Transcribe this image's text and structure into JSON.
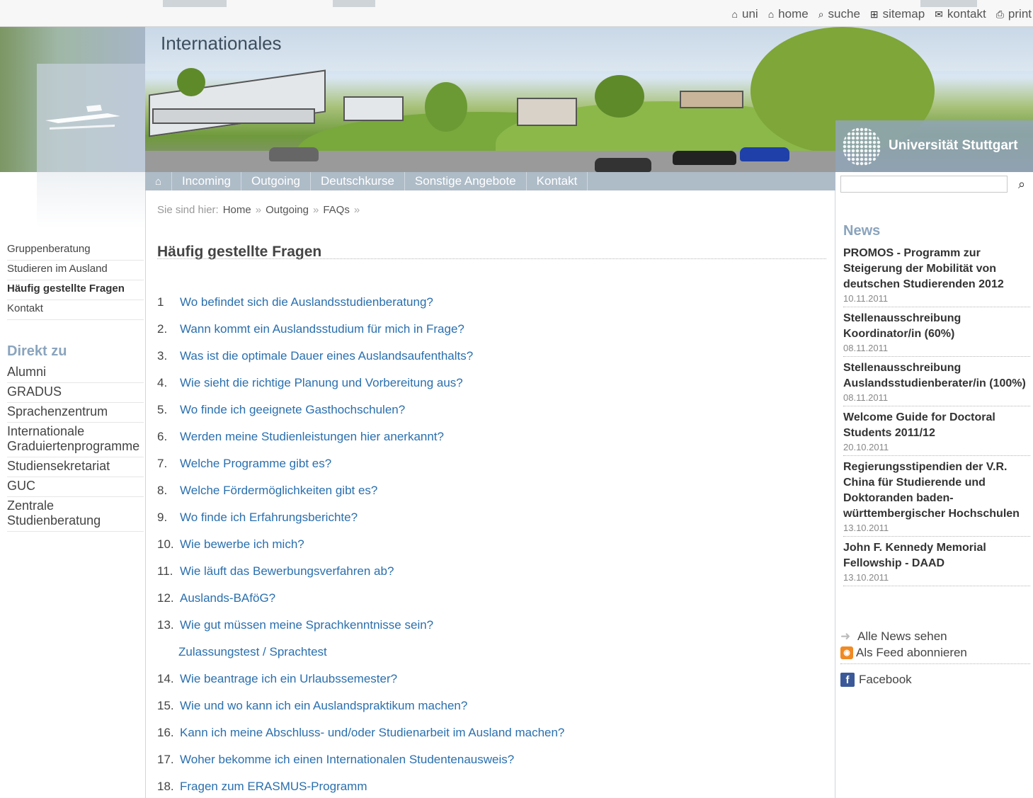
{
  "utility_links": [
    {
      "icon": "house-icon",
      "glyph": "⌂",
      "label": "uni"
    },
    {
      "icon": "house-icon",
      "glyph": "⌂",
      "label": "home"
    },
    {
      "icon": "magnifier-icon",
      "glyph": "⌕",
      "label": "suche"
    },
    {
      "icon": "sitemap-icon",
      "glyph": "⊞",
      "label": "sitemap"
    },
    {
      "icon": "envelope-icon",
      "glyph": "✉",
      "label": "kontakt"
    },
    {
      "icon": "printer-icon",
      "glyph": "⎙",
      "label": "print"
    }
  ],
  "header": {
    "section_title": "Internationales",
    "university_name": "Universität Stuttgart"
  },
  "nav": {
    "home_icon": "house-icon",
    "items": [
      "Incoming",
      "Outgoing",
      "Deutschkurse",
      "Sonstige Angebote",
      "Kontakt"
    ]
  },
  "left_nav": {
    "items": [
      "Gruppenberatung",
      "Studieren im Ausland",
      "Häufig gestellte Fragen",
      "Kontakt"
    ],
    "active_index": 2
  },
  "direkt_zu": {
    "title": "Direkt zu",
    "items": [
      "Alumni",
      "GRADUS",
      "Sprachenzentrum",
      "Internationale Graduiertenprogramme",
      "Studiensekretariat",
      "GUC",
      "Zentrale Studienberatung"
    ]
  },
  "breadcrumb": {
    "prefix": "Sie sind hier:",
    "items": [
      "Home",
      "Outgoing",
      "FAQs"
    ],
    "separator": "»"
  },
  "main": {
    "title": "Häufig gestellte Fragen",
    "faqs": [
      {
        "num": "1",
        "text": "Wo befindet sich die Auslandsstudienberatung?"
      },
      {
        "num": "2.",
        "text": "Wann kommt ein Auslandsstudium für mich in Frage?"
      },
      {
        "num": "3.",
        "text": "Was ist die optimale Dauer eines Auslandsaufenthalts?"
      },
      {
        "num": "4.",
        "text": "Wie sieht die richtige Planung und Vorbereitung aus?"
      },
      {
        "num": "5.",
        "text": "Wo finde ich geeignete Gasthochschulen?"
      },
      {
        "num": "6.",
        "text": "Werden meine Studienleistungen hier anerkannt?"
      },
      {
        "num": "7.",
        "text": "Welche Programme gibt es?"
      },
      {
        "num": "8.",
        "text": "Welche Fördermöglichkeiten gibt es?"
      },
      {
        "num": "9.",
        "text": "Wo finde ich Erfahrungsberichte?"
      },
      {
        "num": "10.",
        "text": "Wie bewerbe ich mich?"
      },
      {
        "num": "11.",
        "text": "Wie läuft das Bewerbungsverfahren ab?"
      },
      {
        "num": "12.",
        "text": "Auslands-BAföG?"
      },
      {
        "num": "13.",
        "text": "Wie gut müssen meine Sprachkenntnisse sein?"
      },
      {
        "num": "",
        "text": "Zulassungstest / Sprachtest"
      },
      {
        "num": "14.",
        "text": "Wie beantrage ich ein Urlaubssemester?"
      },
      {
        "num": "15.",
        "text": "Wie und wo kann ich ein Auslandspraktikum machen?"
      },
      {
        "num": "16.",
        "text": "Kann ich meine Abschluss- und/oder Studienarbeit im Ausland machen?"
      },
      {
        "num": "17.",
        "text": "Woher bekomme ich einen Internationalen Studentenausweis?"
      },
      {
        "num": "18.",
        "text": "Fragen zum ERASMUS-Programm"
      }
    ]
  },
  "search": {
    "value": "",
    "placeholder": ""
  },
  "news": {
    "title": "News",
    "items": [
      {
        "headline": "PROMOS - Programm zur Steigerung der Mobilität von deutschen Studierenden 2012",
        "date": "10.11.2011"
      },
      {
        "headline": "Stellenausschreibung Koordinator/in (60%)",
        "date": "08.11.2011"
      },
      {
        "headline": "Stellenausschreibung Auslandsstudienberater/in (100%)",
        "date": "08.11.2011"
      },
      {
        "headline": "Welcome Guide for Doctoral Students 2011/12",
        "date": "20.10.2011"
      },
      {
        "headline": "Regierungsstipendien der V.R. China für Studierende und Doktoranden baden-württembergischer Hochschulen",
        "date": "13.10.2011"
      },
      {
        "headline": "John F. Kennedy Memorial Fellowship - DAAD",
        "date": "13.10.2011"
      }
    ],
    "all_news_label": "Alle News sehen",
    "feed_label": "Als Feed abonnieren",
    "facebook_label": "Facebook"
  },
  "colors": {
    "link": "#2a6fae",
    "nav_bar": "#aebcc8",
    "heading_accent": "#8aa4bd"
  }
}
